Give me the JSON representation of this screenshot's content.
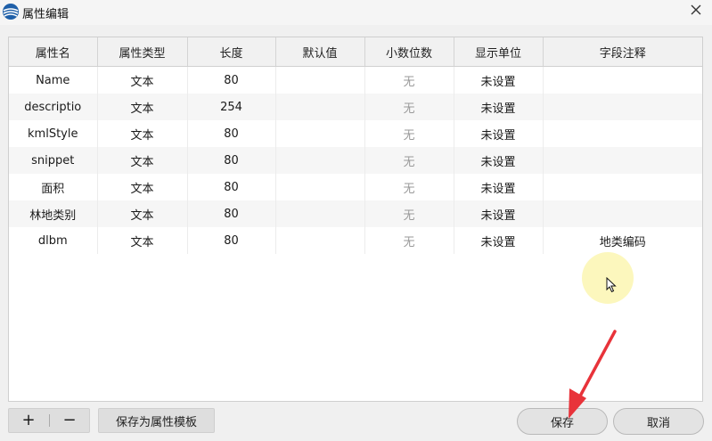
{
  "window": {
    "title": "属性编辑",
    "close_symbol": "✕"
  },
  "table": {
    "headers": [
      "属性名",
      "属性类型",
      "长度",
      "默认值",
      "小数位数",
      "显示单位",
      "字段注释"
    ],
    "rows": [
      {
        "name": "Name",
        "type": "文本",
        "length": "80",
        "default": "",
        "decimals": "无",
        "unit": "未设置",
        "comment": ""
      },
      {
        "name": "descriptio",
        "type": "文本",
        "length": "254",
        "default": "",
        "decimals": "无",
        "unit": "未设置",
        "comment": ""
      },
      {
        "name": "kmlStyle",
        "type": "文本",
        "length": "80",
        "default": "",
        "decimals": "无",
        "unit": "未设置",
        "comment": ""
      },
      {
        "name": "snippet",
        "type": "文本",
        "length": "80",
        "default": "",
        "decimals": "无",
        "unit": "未设置",
        "comment": ""
      },
      {
        "name": "面积",
        "type": "文本",
        "length": "80",
        "default": "",
        "decimals": "无",
        "unit": "未设置",
        "comment": ""
      },
      {
        "name": "林地类别",
        "type": "文本",
        "length": "80",
        "default": "",
        "decimals": "无",
        "unit": "未设置",
        "comment": ""
      },
      {
        "name": "dlbm",
        "type": "文本",
        "length": "80",
        "default": "",
        "decimals": "无",
        "unit": "未设置",
        "comment": "地类编码"
      }
    ]
  },
  "toolbar": {
    "add_symbol": "+",
    "remove_symbol": "−",
    "save_template_label": "保存为属性模板",
    "save_label": "保存",
    "cancel_label": "取消"
  },
  "icons": {
    "app": "app-logo-icon",
    "close": "close-icon",
    "cursor": "mouse-pointer-icon",
    "annotation": "red-arrow-icon"
  },
  "colors": {
    "annotation_arrow": "#e8333a",
    "cursor_highlight": "#fcf6b2"
  }
}
